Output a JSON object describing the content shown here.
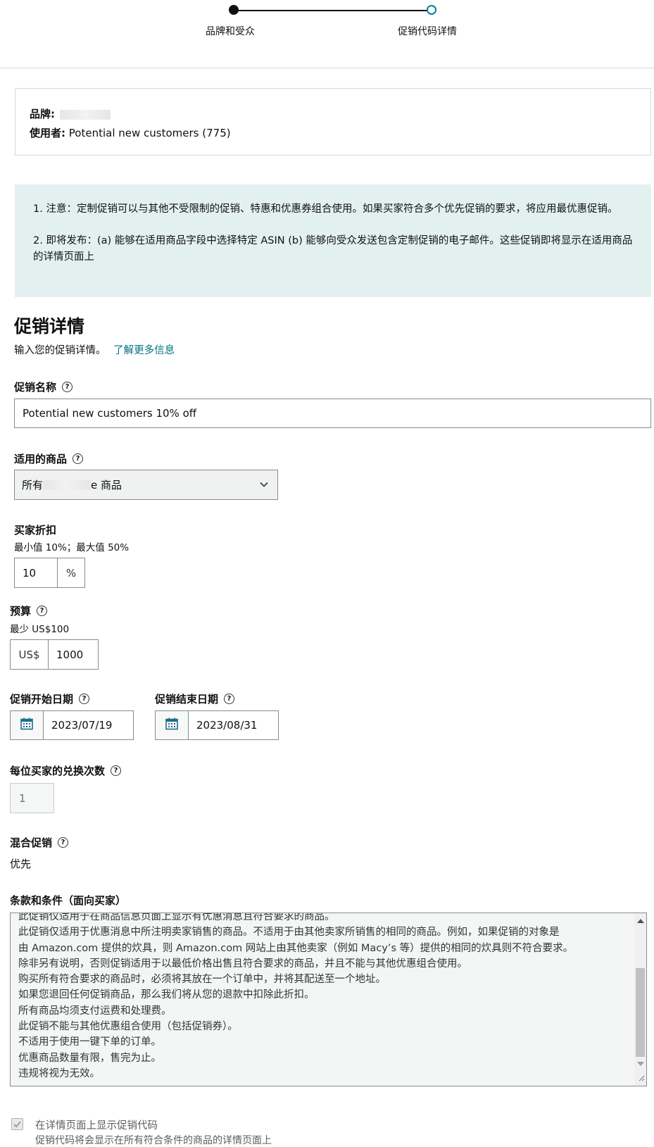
{
  "stepper": {
    "steps": [
      {
        "label": "品牌和受众",
        "state": "complete"
      },
      {
        "label": "促销代码详情",
        "state": "current"
      }
    ],
    "accent": "#0f1111",
    "current_color": "#008296"
  },
  "summary": {
    "brand_label": "品牌:",
    "audience_label": "使用者:",
    "audience_value": "Potential new customers (775)"
  },
  "notice": {
    "items": [
      "1. 注意：定制促销可以与其他不受限制的促销、特惠和优惠券组合使用。如果买家符合多个优先促销的要求，将应用最优惠促销。",
      "2. 即将发布：(a) 能够在适用商品字段中选择特定 ASIN (b) 能够向受众发送包含定制促销的电子邮件。这些促销即将显示在适用商品的详情页面上"
    ],
    "background": "#e3f0f0"
  },
  "details": {
    "title": "促销详情",
    "subtitle": "输入您的促销详情。",
    "learn_more": "了解更多信息"
  },
  "promo_name": {
    "label": "促销名称",
    "value": "Potential new customers  10% off"
  },
  "applicable": {
    "label": "适用的商品",
    "value_prefix": "所有",
    "value_suffix": "e 商品"
  },
  "discount": {
    "label": "买家折扣",
    "hint": "最小值 10%；最大值 50%",
    "value": "10",
    "unit": "%"
  },
  "budget": {
    "label": "预算",
    "hint": "最少 US$100",
    "currency": "US$",
    "value": "1000"
  },
  "dates": {
    "start_label": "促销开始日期",
    "start_value": "2023/07/19",
    "end_label": "促销结束日期",
    "end_value": "2023/08/31"
  },
  "redemptions": {
    "label": "每位买家的兑换次数",
    "value": "1"
  },
  "stacking": {
    "label": "混合促销",
    "value": "优先"
  },
  "terms": {
    "label": "条款和条件（面向买家）",
    "lines": [
      "此促销仅适用于在商品信息页面上显示有优惠消息且符合要求的商品。",
      "此促销仅适用于优惠消息中所注明卖家销售的商品。不适用于由其他卖家所销售的相同的商品。例如，如果促销的对象是",
      "由 Amazon.com 提供的炊具，则 Amazon.com 网站上由其他卖家（例如 Macy’s 等）提供的相同的炊具则不符合要求。",
      "除非另有说明，否则促销适用于以最低价格出售且符合要求的商品，并且不能与其他优惠组合使用。",
      "购买所有符合要求的商品时，必须将其放在一个订单中，并将其配送至一个地址。",
      "如果您退回任何促销商品，那么我们将从您的退款中扣除此折扣。",
      "所有商品均须支付运费和处理费。",
      "此促销不能与其他优惠组合使用（包括促销券）。",
      "不适用于使用一键下单的订单。",
      "优惠商品数量有限，售完为止。",
      "违规将视为无效。"
    ]
  },
  "show_code": {
    "label": "在详情页面上显示促销代码",
    "hint": "促销代码将会显示在所有符合条件的商品的详情页面上",
    "checked": true
  },
  "help_glyph": "?",
  "select_icon": "chevron-down-icon",
  "calendar_icon": "calendar-icon"
}
